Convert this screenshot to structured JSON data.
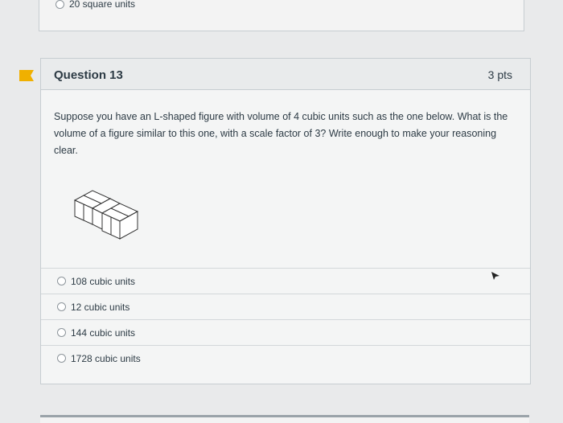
{
  "previous_question": {
    "option_label": "20 square units"
  },
  "question": {
    "title": "Question 13",
    "points": "3 pts",
    "text": "Suppose you have an L-shaped figure with volume of 4 cubic units such as the one below. What is the volume of a figure similar to this one, with a scale factor of 3? Write enough to make your reasoning clear.",
    "figure_icon": "l-shaped-cubes-figure",
    "answers": [
      "108 cubic units",
      "12 cubic units",
      "144 cubic units",
      "1728 cubic units"
    ]
  },
  "colors": {
    "flag": "#f0b000",
    "card_background": "#f4f5f5",
    "header_background": "#e9ebec",
    "border": "#c7cdd1",
    "text": "#2d3b45"
  }
}
